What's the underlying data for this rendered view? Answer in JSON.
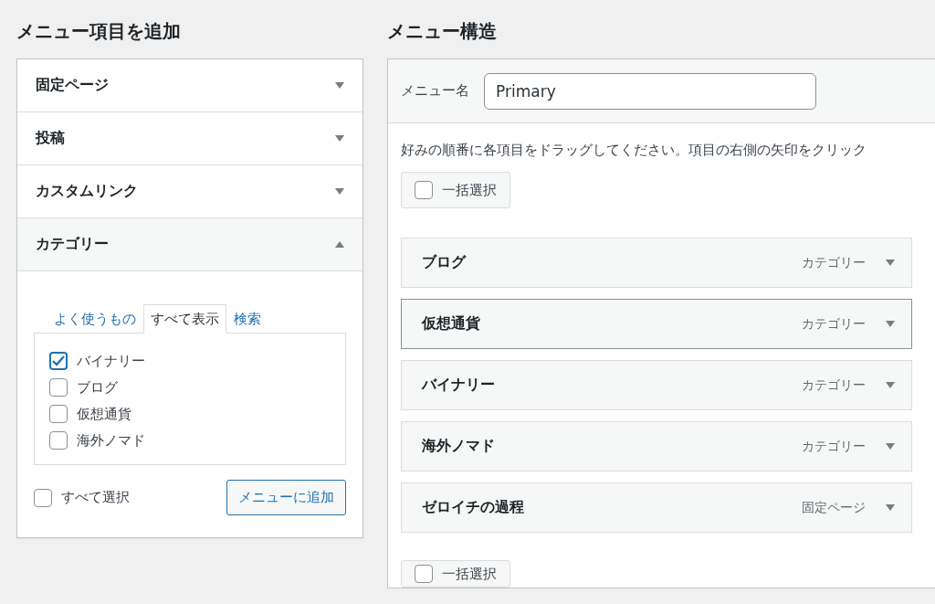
{
  "add_panel": {
    "title": "メニュー項目を追加",
    "sections": [
      {
        "label": "固定ページ",
        "expanded": false
      },
      {
        "label": "投稿",
        "expanded": false
      },
      {
        "label": "カスタムリンク",
        "expanded": false
      },
      {
        "label": "カテゴリー",
        "expanded": true
      }
    ],
    "tabs": [
      {
        "label": "よく使うもの",
        "selected": false
      },
      {
        "label": "すべて表示",
        "selected": true
      },
      {
        "label": "検索",
        "selected": false
      }
    ],
    "categories": [
      {
        "label": "バイナリー",
        "checked": true
      },
      {
        "label": "ブログ",
        "checked": false
      },
      {
        "label": "仮想通貨",
        "checked": false
      },
      {
        "label": "海外ノマド",
        "checked": false
      }
    ],
    "select_all": {
      "label": "すべて選択",
      "checked": false
    },
    "add_button": "メニューに追加"
  },
  "structure": {
    "title": "メニュー構造",
    "menu_name_label": "メニュー名",
    "menu_name": "Primary",
    "instructions": "好みの順番に各項目をドラッグしてください。項目の右側の矢印をクリック",
    "bulk_select_top": {
      "label": "一括選択",
      "checked": false
    },
    "items": [
      {
        "title": "ブログ",
        "type": "カテゴリー",
        "selected": false
      },
      {
        "title": "仮想通貨",
        "type": "カテゴリー",
        "selected": true
      },
      {
        "title": "バイナリー",
        "type": "カテゴリー",
        "selected": false
      },
      {
        "title": "海外ノマド",
        "type": "カテゴリー",
        "selected": false
      },
      {
        "title": "ゼロイチの過程",
        "type": "固定ページ",
        "selected": false
      }
    ],
    "bulk_select_bottom": {
      "label": "一括選択",
      "checked": false
    }
  }
}
